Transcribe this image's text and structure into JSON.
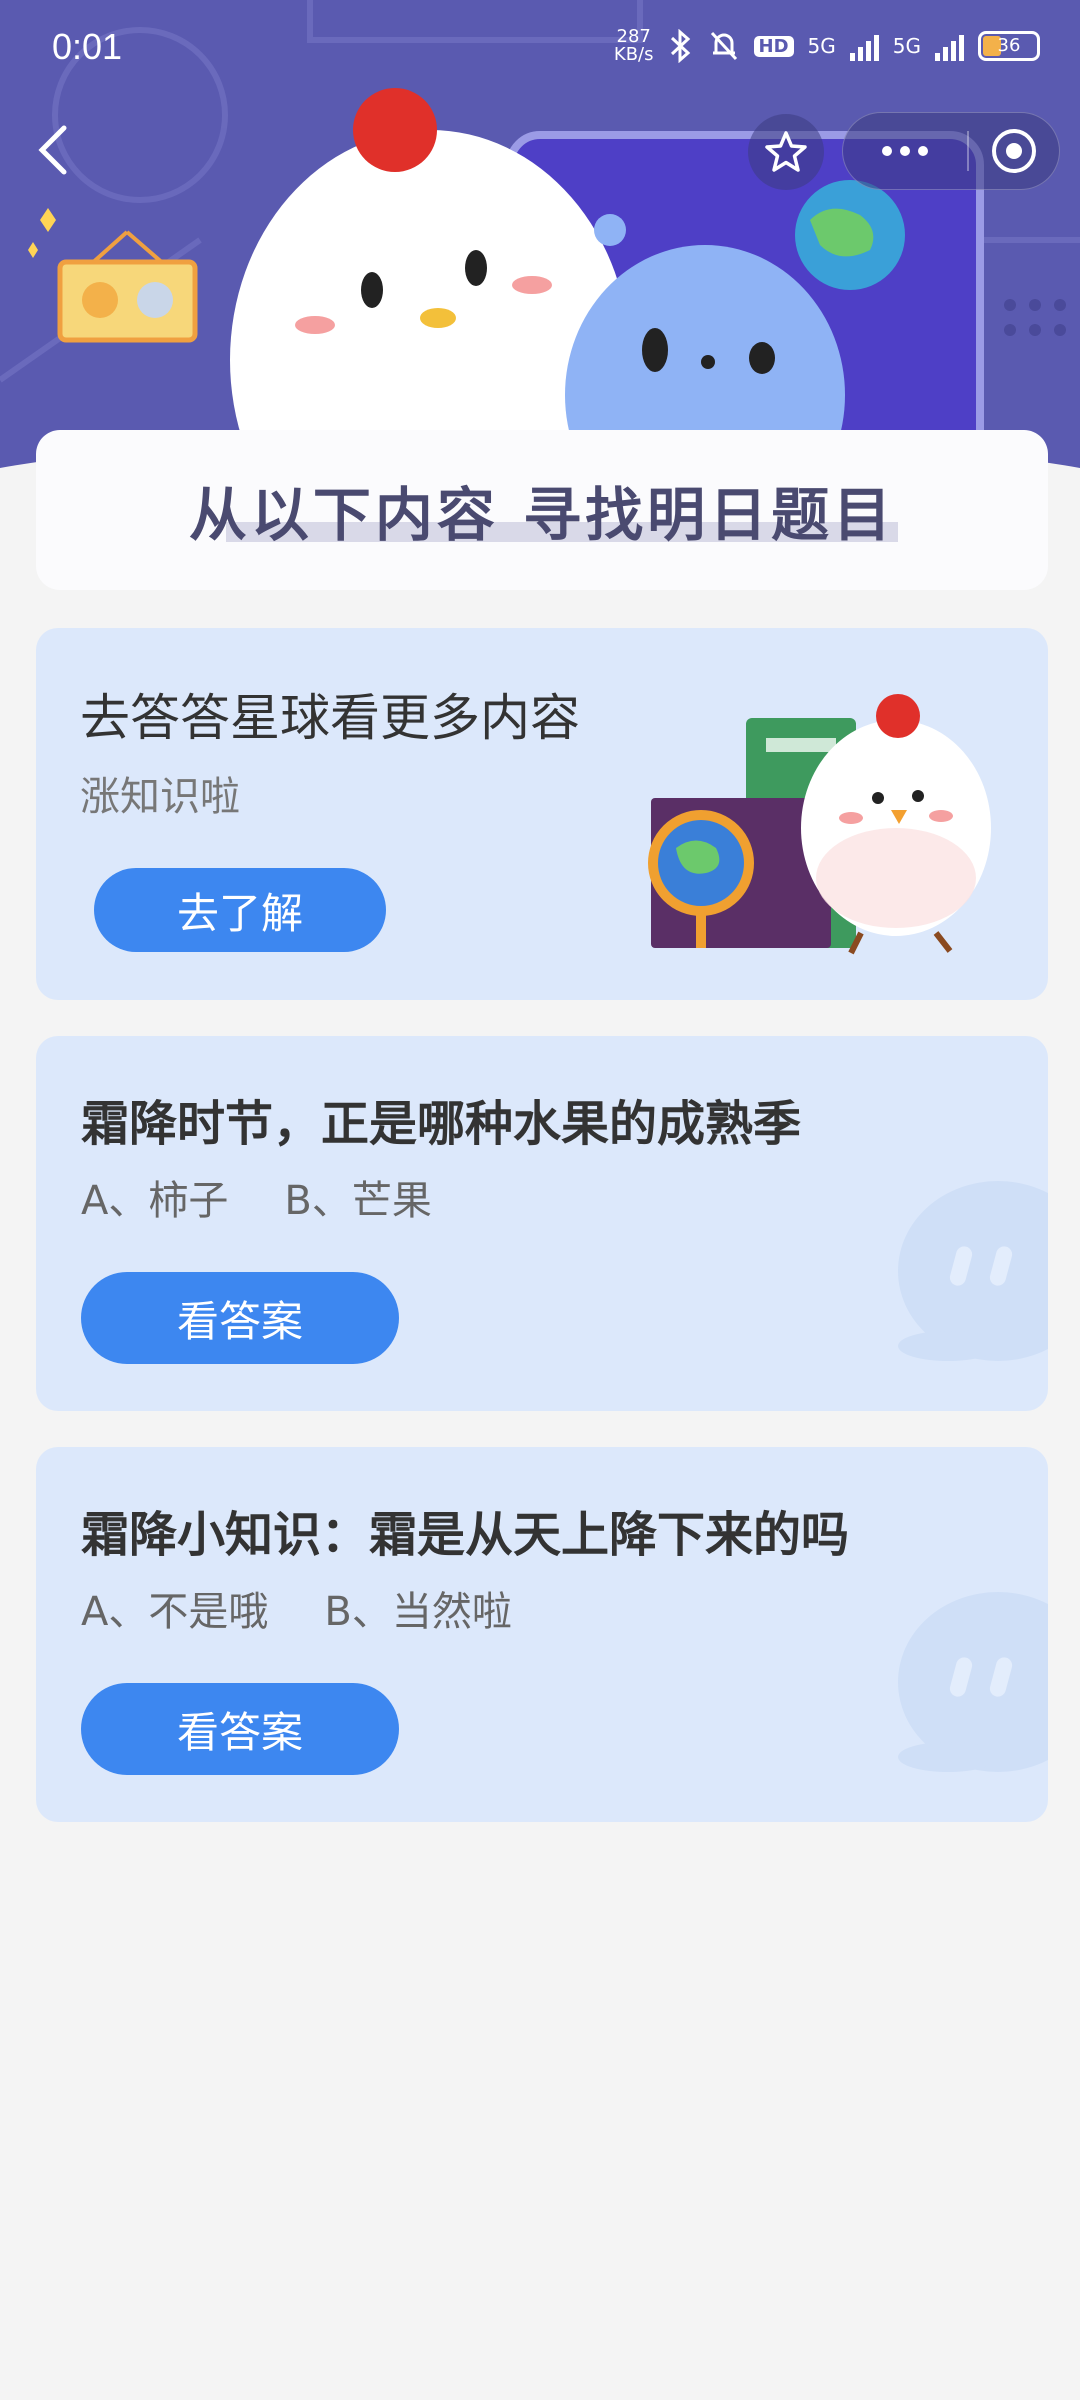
{
  "status_bar": {
    "time": "0:01",
    "net_speed_value": "287",
    "net_speed_unit": "KB/s",
    "hd_label": "HD",
    "signal1_label": "5G",
    "signal2_label": "5G",
    "battery": "36"
  },
  "banner": {
    "title": "从以下内容  寻找明日题目"
  },
  "promo_card": {
    "title": "去答答星球看更多内容",
    "subtitle": "涨知识啦",
    "button_label": "去了解"
  },
  "questions": [
    {
      "title": "霜降时节，正是哪种水果的成熟季",
      "option_a": "A、柿子",
      "option_b": "B、芒果",
      "button_label": "看答案"
    },
    {
      "title": "霜降小知识：霜是从天上降下来的吗",
      "option_a": "A、不是哦",
      "option_b": "B、当然啦",
      "button_label": "看答案"
    }
  ],
  "colors": {
    "header_bg": "#5a5ab0",
    "card_bg": "#dce8fb",
    "button_blue": "#3d87f0",
    "page_bg": "#f4f4f4"
  }
}
